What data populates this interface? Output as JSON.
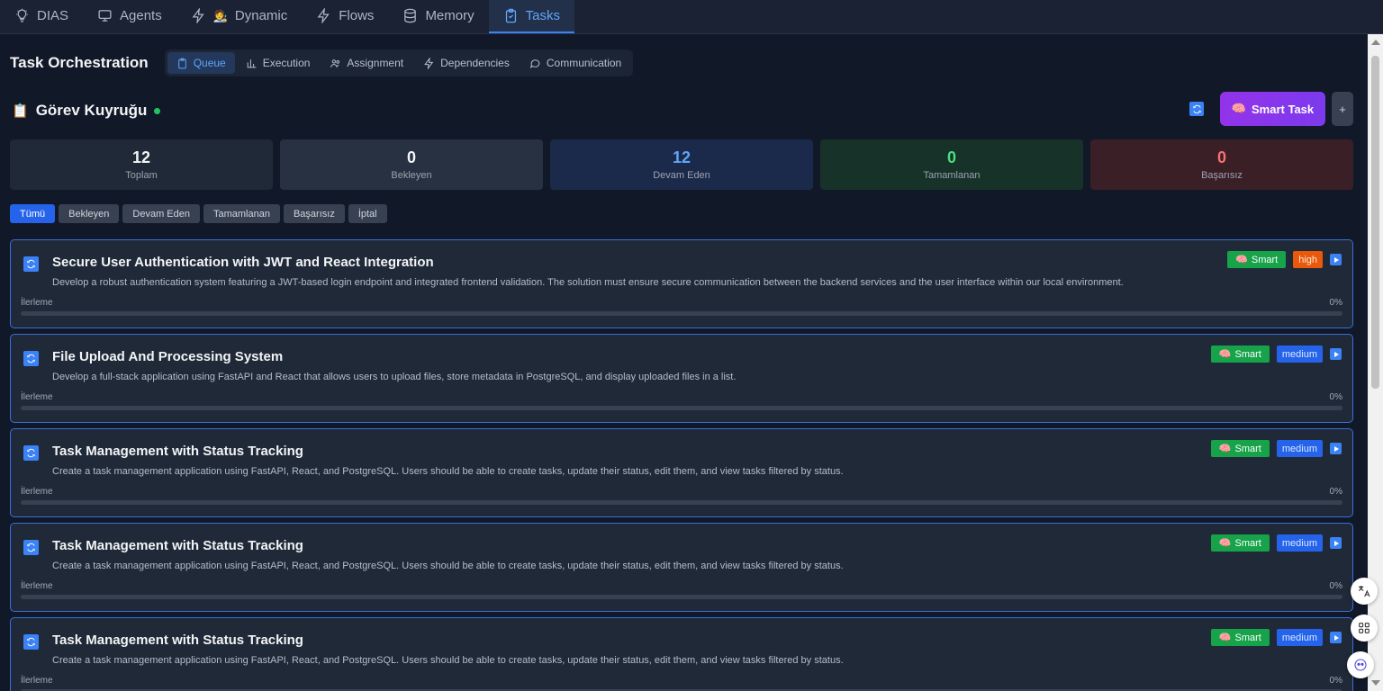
{
  "nav": {
    "items": [
      {
        "label": "DIAS",
        "icon": "lightbulb-icon"
      },
      {
        "label": "Agents",
        "icon": "monitor-icon"
      },
      {
        "label": "Dynamic",
        "icon": "bolt-icon",
        "emoji": "🧑‍🎨"
      },
      {
        "label": "Flows",
        "icon": "bolt-icon"
      },
      {
        "label": "Memory",
        "icon": "database-icon"
      },
      {
        "label": "Tasks",
        "icon": "clipboard-check-icon",
        "active": true
      }
    ]
  },
  "section": {
    "title": "Task Orchestration",
    "tabs": [
      {
        "label": "Queue",
        "icon": "clipboard-icon",
        "active": true
      },
      {
        "label": "Execution",
        "icon": "bar-chart-icon"
      },
      {
        "label": "Assignment",
        "icon": "users-icon"
      },
      {
        "label": "Dependencies",
        "icon": "bolt-icon"
      },
      {
        "label": "Communication",
        "icon": "chat-bubble-icon"
      }
    ]
  },
  "queue": {
    "emoji": "📋",
    "title": "Görev Kuyruğu",
    "smart_task_label": "Smart Task",
    "smart_task_emoji": "🧠",
    "plus_label": "+"
  },
  "stats": [
    {
      "value": "12",
      "label": "Toplam"
    },
    {
      "value": "0",
      "label": "Bekleyen"
    },
    {
      "value": "12",
      "label": "Devam Eden"
    },
    {
      "value": "0",
      "label": "Tamamlanan"
    },
    {
      "value": "0",
      "label": "Başarısız"
    }
  ],
  "filters": [
    "Tümü",
    "Bekleyen",
    "Devam Eden",
    "Tamamlanan",
    "Başarısız",
    "İptal"
  ],
  "progress_label": "İlerleme",
  "tasks": [
    {
      "title": "Secure User Authentication with JWT and React Integration",
      "description": "Develop a robust authentication system featuring a JWT-based login endpoint and integrated frontend validation. The solution must ensure secure communication between the backend services and the user interface within our local environment.",
      "smart": "Smart",
      "priority": "high",
      "progress_text": "0%",
      "progress": 0
    },
    {
      "title": "File Upload And Processing System",
      "description": "Develop a full-stack application using FastAPI and React that allows users to upload files, store metadata in PostgreSQL, and display uploaded files in a list.",
      "smart": "Smart",
      "priority": "medium",
      "progress_text": "0%",
      "progress": 0
    },
    {
      "title": "Task Management with Status Tracking",
      "description": "Create a task management application using FastAPI, React, and PostgreSQL. Users should be able to create tasks, update their status, edit them, and view tasks filtered by status.",
      "smart": "Smart",
      "priority": "medium",
      "progress_text": "0%",
      "progress": 0
    },
    {
      "title": "Task Management with Status Tracking",
      "description": "Create a task management application using FastAPI, React, and PostgreSQL. Users should be able to create tasks, update their status, edit them, and view tasks filtered by status.",
      "smart": "Smart",
      "priority": "medium",
      "progress_text": "0%",
      "progress": 0
    },
    {
      "title": "Task Management with Status Tracking",
      "description": "Create a task management application using FastAPI, React, and PostgreSQL. Users should be able to create tasks, update their status, edit them, and view tasks filtered by status.",
      "smart": "Smart",
      "priority": "medium",
      "progress_text": "0%",
      "progress": 0
    }
  ],
  "colors": {
    "accent": "#3b82f6",
    "smart_badge": "#16a34a",
    "high_badge": "#ea580c",
    "medium_badge": "#2563eb",
    "smart_task_button": "#9333ea"
  }
}
